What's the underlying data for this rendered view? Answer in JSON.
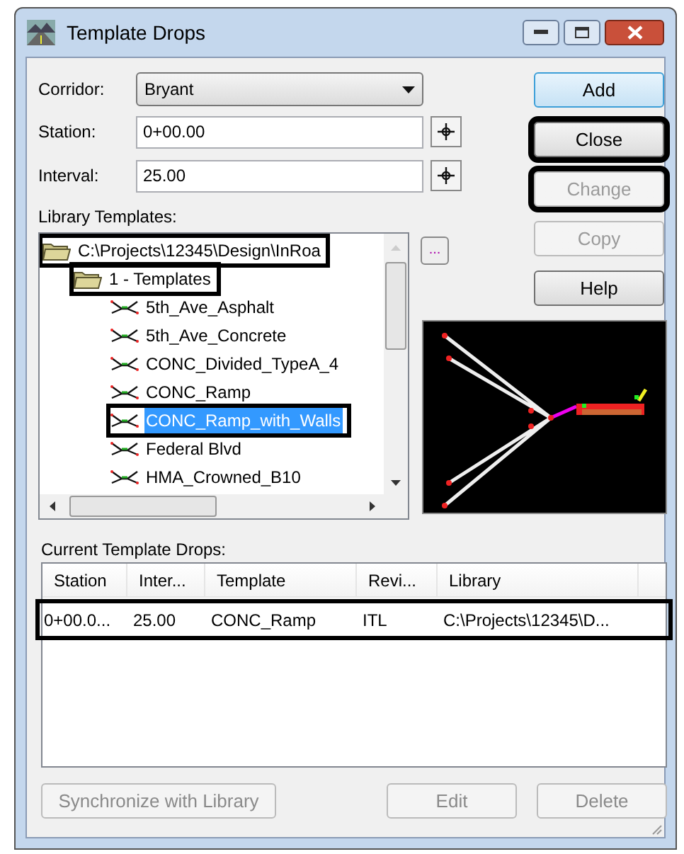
{
  "window": {
    "title": "Template Drops"
  },
  "corridor": {
    "label": "Corridor:",
    "value": "Bryant"
  },
  "station": {
    "label": "Station:",
    "value": "0+00.00"
  },
  "interval": {
    "label": "Interval:",
    "value": "25.00"
  },
  "side_buttons": [
    {
      "label": "Add",
      "kind": "default",
      "disabled": false,
      "highlighted": false
    },
    {
      "label": "Close",
      "kind": "normal",
      "disabled": false,
      "highlighted": true
    },
    {
      "label": "Change",
      "kind": "normal",
      "disabled": true,
      "highlighted": true
    },
    {
      "label": "Copy",
      "kind": "normal",
      "disabled": true,
      "highlighted": false
    },
    {
      "label": "Help",
      "kind": "normal",
      "disabled": false,
      "highlighted": false
    }
  ],
  "library": {
    "label": "Library Templates:",
    "browse_button": "...",
    "tree": [
      {
        "label": "C:\\Projects\\12345\\Design\\InRoa",
        "kind": "folder",
        "selected": false,
        "highlighted": true,
        "children": [
          {
            "label": "1 - Templates",
            "kind": "folder",
            "selected": false,
            "highlighted": true,
            "children": [
              {
                "label": "5th_Ave_Asphalt",
                "kind": "template",
                "selected": false,
                "highlighted": false
              },
              {
                "label": "5th_Ave_Concrete",
                "kind": "template",
                "selected": false,
                "highlighted": false
              },
              {
                "label": "CONC_Divided_TypeA_4",
                "kind": "template",
                "selected": false,
                "highlighted": false
              },
              {
                "label": "CONC_Ramp",
                "kind": "template",
                "selected": false,
                "highlighted": false
              },
              {
                "label": "CONC_Ramp_with_Walls",
                "kind": "template",
                "selected": true,
                "highlighted": true
              },
              {
                "label": "Federal Blvd",
                "kind": "template",
                "selected": false,
                "highlighted": false
              },
              {
                "label": "HMA_Crowned_B10",
                "kind": "template",
                "selected": false,
                "highlighted": false
              }
            ]
          }
        ]
      }
    ]
  },
  "current_drops": {
    "label": "Current Template Drops:",
    "columns": [
      "Station",
      "Inter...",
      "Template",
      "Revi...",
      "Library"
    ],
    "rows": [
      {
        "cells": [
          "0+00.0...",
          "25.00",
          "CONC_Ramp",
          "ITL",
          "C:\\Projects\\12345\\D..."
        ],
        "highlighted": true
      }
    ]
  },
  "bottom_buttons": [
    {
      "label": "Synchronize with Library",
      "disabled": true
    },
    {
      "label": "Edit",
      "disabled": true
    },
    {
      "label": "Delete",
      "disabled": true
    }
  ]
}
